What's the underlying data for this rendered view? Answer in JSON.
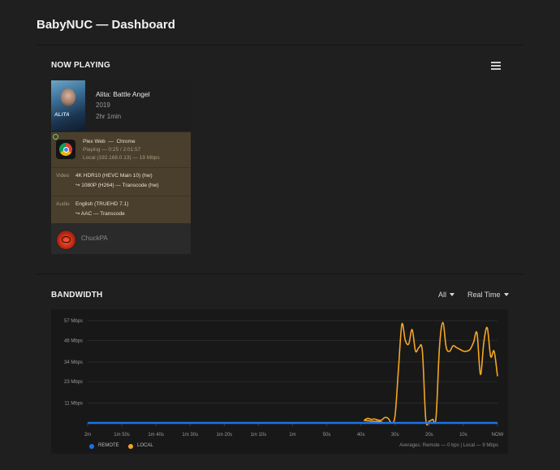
{
  "header": {
    "title": "BabyNUC — Dashboard"
  },
  "now_playing": {
    "section_title": "NOW PLAYING",
    "movie": {
      "title": "Alita: Battle Angel",
      "year": "2019",
      "duration": "2hr 1min",
      "poster_text": "ALITA"
    },
    "player": {
      "name": "Plex Web",
      "separator": "—",
      "app": "Chrome",
      "status": "Playing — 0:25 / 2:01:57",
      "network": "Local (192.168.0.13) — 19 Mbps"
    },
    "video": {
      "label": "Video",
      "source": "4K HDR10 (HEVC Main 10) (hw)",
      "target": "↪ 1080P (H264) — Transcode (hw)"
    },
    "audio": {
      "label": "Audio",
      "source": "English (TRUEHD 7.1)",
      "target": "↪ AAC — Transcode"
    },
    "user": {
      "name": "ChuckPA"
    }
  },
  "bandwidth": {
    "section_title": "BANDWIDTH",
    "filter_scope": "All",
    "filter_range": "Real Time",
    "averages": "Averages: Remote — 0 bps | Local — 9 Mbps"
  },
  "colors": {
    "remote": "#1a73e8",
    "local": "#f5a623",
    "panel": "#4a3f2c"
  },
  "chart_data": {
    "type": "line",
    "x": [
      "2m",
      "1m 50s",
      "1m 40s",
      "1m 30s",
      "1m 20s",
      "1m 10s",
      "1m",
      "50s",
      "40s",
      "30s",
      "20s",
      "10s",
      "NOW"
    ],
    "y_ticks": [
      "57 Mbps",
      "46 Mbps",
      "34 Mbps",
      "23 Mbps",
      "11 Mbps"
    ],
    "ylim": [
      0,
      57
    ],
    "series": [
      {
        "name": "REMOTE",
        "color": "#1a73e8",
        "values": [
          [
            0,
            0
          ],
          [
            120,
            0
          ]
        ]
      },
      {
        "name": "LOCAL",
        "color": "#f5a623",
        "values": [
          [
            0,
            0
          ],
          [
            80,
            0
          ],
          [
            81,
            1.5
          ],
          [
            82,
            2.5
          ],
          [
            83,
            2
          ],
          [
            84,
            2.2
          ],
          [
            85,
            1.6
          ],
          [
            86,
            1.5
          ],
          [
            87,
            3
          ],
          [
            88,
            2.5
          ],
          [
            89,
            0
          ],
          [
            90,
            4
          ],
          [
            91,
            30
          ],
          [
            92,
            55
          ],
          [
            93,
            46
          ],
          [
            94,
            44
          ],
          [
            95,
            52
          ],
          [
            96,
            40
          ],
          [
            97,
            42
          ],
          [
            98,
            40
          ],
          [
            99,
            2
          ],
          [
            100,
            1
          ],
          [
            101,
            2
          ],
          [
            102,
            3
          ],
          [
            103,
            42
          ],
          [
            104,
            56
          ],
          [
            105,
            42
          ],
          [
            106,
            40
          ],
          [
            107,
            43
          ],
          [
            108,
            42
          ],
          [
            109,
            41
          ],
          [
            110,
            40
          ],
          [
            111,
            40
          ],
          [
            112,
            41
          ],
          [
            113,
            45
          ],
          [
            114,
            50
          ],
          [
            115,
            27
          ],
          [
            116,
            45
          ],
          [
            117,
            53
          ],
          [
            118,
            37
          ],
          [
            119,
            40
          ],
          [
            120,
            26
          ]
        ]
      }
    ],
    "grid": true,
    "legend_position": "bottom-left"
  }
}
